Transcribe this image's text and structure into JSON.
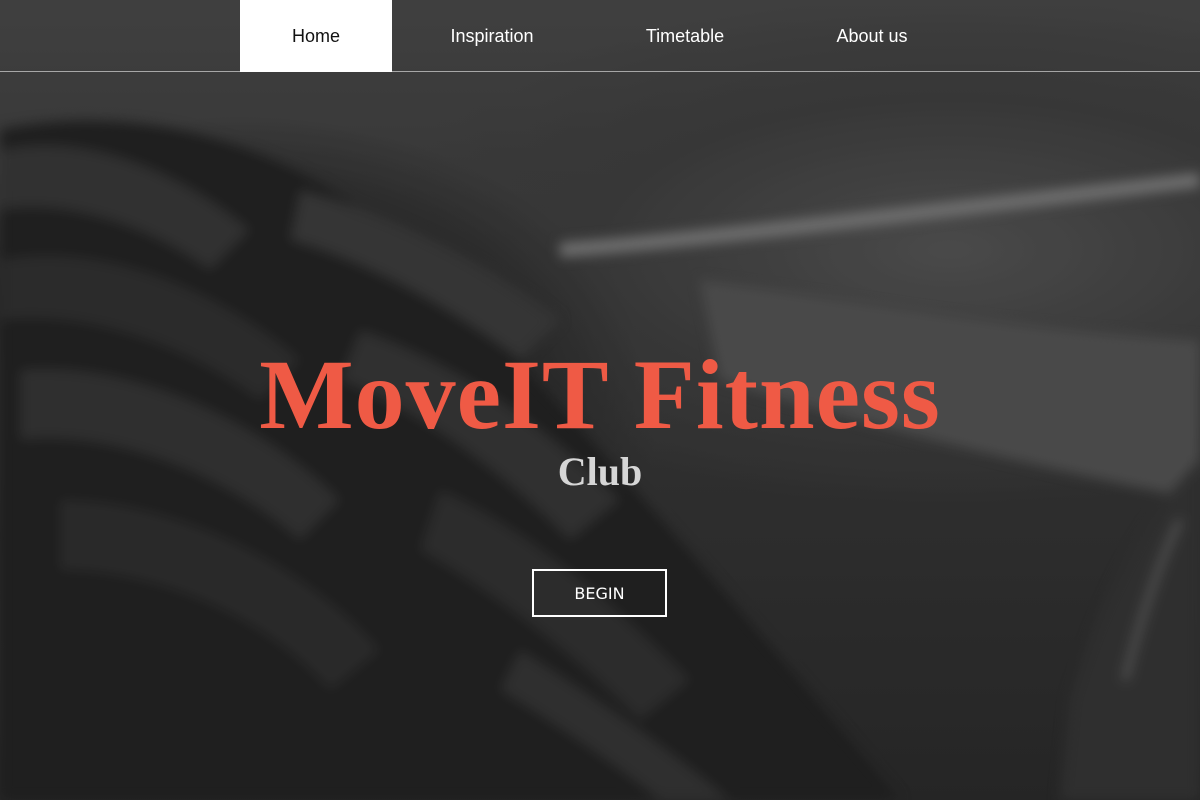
{
  "nav": {
    "items": [
      {
        "label": "Home",
        "active": true
      },
      {
        "label": "Inspiration",
        "active": false
      },
      {
        "label": "Timetable",
        "active": false
      },
      {
        "label": "About us",
        "active": false
      }
    ]
  },
  "hero": {
    "title": "MoveIT Fitness",
    "subtitle": "Club",
    "button_label": "BEGIN",
    "background": "blurred-tire-photo"
  },
  "colors": {
    "accent": "#ef5a45",
    "subtitle": "#d6d6d6",
    "nav_active_bg": "#ffffff"
  }
}
